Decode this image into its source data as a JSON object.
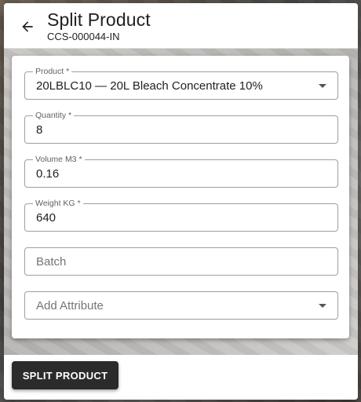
{
  "header": {
    "title": "Split Product",
    "subtitle": "CCS-000044-IN",
    "back_icon": "arrow-left-icon"
  },
  "form": {
    "product": {
      "label": "Product *",
      "value": "20LBLC10 — 20L Bleach Concentrate 10%"
    },
    "quantity": {
      "label": "Quantity *",
      "value": "8"
    },
    "volume": {
      "label": "Volume M3 *",
      "value": "0.16"
    },
    "weight": {
      "label": "Weight KG *",
      "value": "640"
    },
    "batch": {
      "placeholder": "Batch",
      "value": ""
    },
    "attribute": {
      "placeholder": "Add Attribute"
    }
  },
  "footer": {
    "split_label": "SPLIT PRODUCT"
  },
  "colors": {
    "primary_button": "#2b2b2b",
    "field_border": "#9e9e9e"
  }
}
